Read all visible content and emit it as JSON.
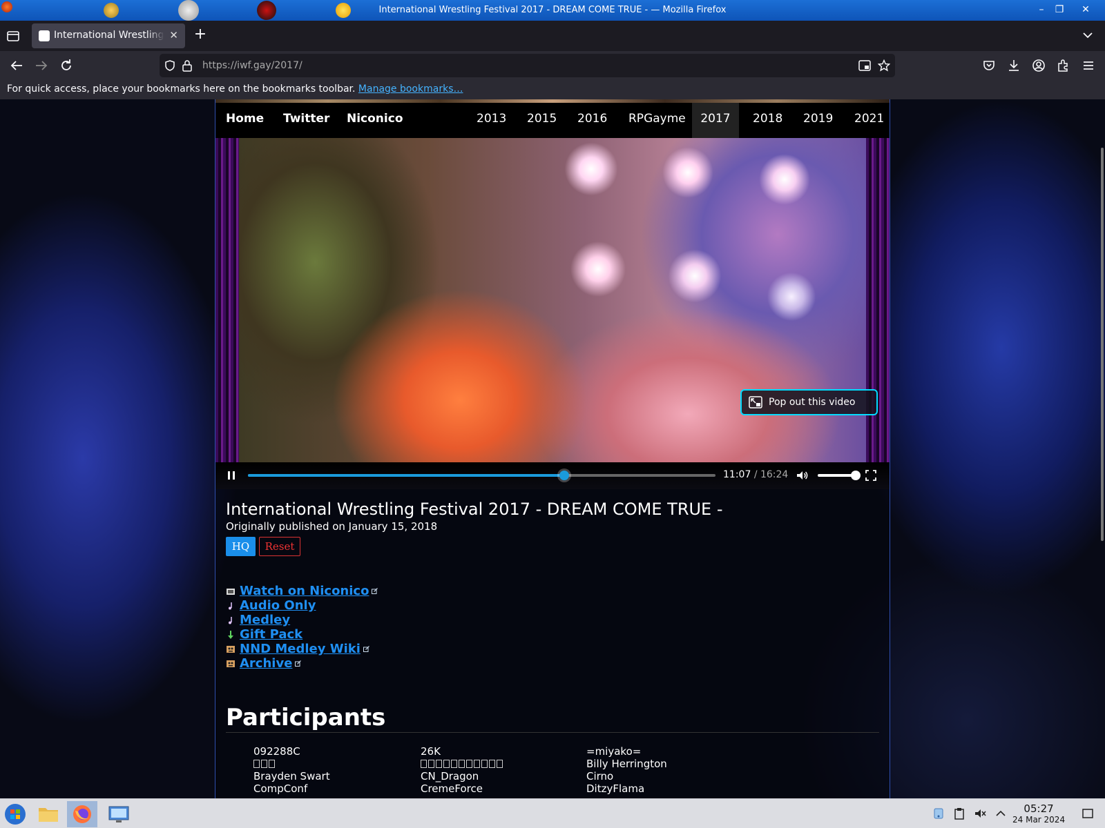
{
  "window": {
    "title": "International Wrestling Festival 2017 - DREAM COME TRUE - — Mozilla Firefox"
  },
  "browser": {
    "tab_title": "International Wrestling Festival 2017 - DREAM COME TRUE -",
    "url_host": "https://iwf.gay",
    "url_path": "/2017/",
    "bookmarks_message": "For quick access, place your bookmarks here on the bookmarks toolbar.",
    "manage_bookmarks": "Manage bookmarks…"
  },
  "site_nav": {
    "left": [
      "Home",
      "Twitter",
      "Niconico"
    ],
    "years": [
      "2013",
      "2015",
      "2016",
      "RPGayme",
      "2017",
      "2018",
      "2019",
      "2021"
    ],
    "active": "2017"
  },
  "video": {
    "current_time": "11:07",
    "duration": "16:24",
    "progress": 0.677,
    "volume": 1.0,
    "popout_label": "Pop out this video"
  },
  "page": {
    "title": "International Wrestling Festival 2017 - DREAM COME TRUE -",
    "published": "Originally published on January 15, 2018",
    "hq_button": "HQ",
    "reset_button": "Reset",
    "links": [
      {
        "label": "Watch on Niconico",
        "icon": "video-icon",
        "external": true
      },
      {
        "label": "Audio Only",
        "icon": "music-note-icon",
        "external": false
      },
      {
        "label": "Medley",
        "icon": "music-note-icon",
        "external": false
      },
      {
        "label": "Gift Pack",
        "icon": "download-arrow-icon",
        "external": false
      },
      {
        "label": "NND Medley Wiki",
        "icon": "wiki-icon",
        "external": true
      },
      {
        "label": "Archive",
        "icon": "archive-icon",
        "external": true
      }
    ],
    "participants_heading": "Participants",
    "participants": [
      [
        "092288C",
        "",
        "Brayden Swart",
        "CompConf"
      ],
      [
        "26K",
        "",
        "CN_Dragon",
        "CremeForce"
      ],
      [
        "=miyako=",
        "Billy Herrington",
        "Cirno",
        "DitzyFlama"
      ]
    ]
  },
  "taskbar": {
    "time": "05:27",
    "date": "24 Mar 2024"
  },
  "colors": {
    "link": "#1f8ff2",
    "progress": "#1a9bdc",
    "hq": "#1a8eea",
    "reset": "#e33333",
    "popout_border": "#00ddff",
    "titlebar": "#1c6fd6"
  }
}
